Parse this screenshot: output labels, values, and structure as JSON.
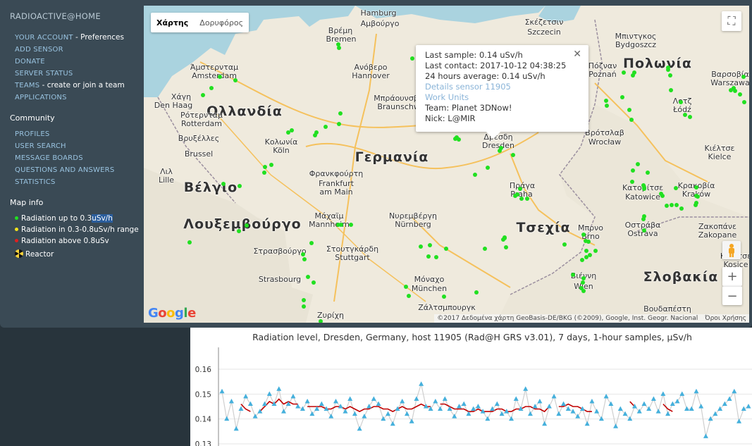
{
  "sidebar": {
    "site_title": "RADIOACTIVE@HOME",
    "nav": [
      {
        "label": "YOUR ACCOUNT",
        "suffix": " - Preferences"
      },
      {
        "label": "ADD SENSOR",
        "suffix": ""
      },
      {
        "label": "DONATE",
        "suffix": ""
      },
      {
        "label": "SERVER STATUS",
        "suffix": ""
      },
      {
        "label": "TEAMS",
        "suffix": " - create or join a team"
      },
      {
        "label": "APPLICATIONS",
        "suffix": ""
      }
    ],
    "community_heading": "Community",
    "community": [
      "PROFILES",
      "USER SEARCH",
      "MESSAGE BOARDS",
      "QUESTIONS AND ANSWERS",
      "STATISTICS"
    ],
    "mapinfo_heading": "Map info",
    "legend": {
      "green_prefix": "Radiation up to 0.3",
      "green_highlight": "uSv/h",
      "yellow": "Radiation in 0.3-0.8uSv/h range",
      "red": "Radiation above 0.8uSv",
      "reactor": "Reactor"
    },
    "colors": {
      "green": "#21e021",
      "yellow": "#f2e21c",
      "red": "#e02020"
    }
  },
  "map": {
    "map_type": {
      "map": "Χάρτης",
      "satellite": "Δορυφόρος"
    },
    "zoom_in": "+",
    "zoom_out": "−",
    "google": "Google",
    "attribution": "©2017 Δεδομένα χάρτη GeoBasis-DE/BKG (©2009), Google, Inst. Geogr. Nacional",
    "terms": "Όροι Χρήσης",
    "countries": [
      "Ολλανδία",
      "Γερμανία",
      "Βέλγιο",
      "Λουξεμβούργο",
      "Πολωνία",
      "Τσεχία",
      "Σλοβακία"
    ],
    "cities": [
      "Hamburg",
      "Βρέμη",
      "Bremen",
      "Αμβούργο",
      "Ανόβερο",
      "Hannover",
      "Μπράουνσβαϊγκ",
      "Braunschweig",
      "Άμστερνταμ",
      "Amsterdam",
      "Χάγη",
      "Den Haag",
      "Ρότερνταμ",
      "Rotterdam",
      "Βρυξέλλες",
      "Brussel",
      "Κολωνία",
      "Köln",
      "Λιλ",
      "Lille",
      "Φρανκφούρτη",
      "Frankfurt",
      "am Main",
      "Μάχαϊμ",
      "Mannheim",
      "Νυρεμβέργη",
      "Nürnberg",
      "Στουτγκάρδη",
      "Stuttgart",
      "Στρασβούργο",
      "Strasbourg",
      "Μόναχο",
      "München",
      "Ζάλτσμπουργκ",
      "Ζυρίχη",
      "Πράγα",
      "Praha",
      "Δρέσδη",
      "Dresden",
      "Μπρνο",
      "Brno",
      "Βιέννη",
      "Wien",
      "Σκέζετσιν",
      "Szczecin",
      "Μπιντγκος",
      "Bydgoszcz",
      "Πόζναν",
      "Poznań",
      "Βαρσοβία",
      "Warszawa",
      "Λοτζ",
      "Łódź",
      "Βρότσλαβ",
      "Wrocław",
      "Κιέλτσε",
      "Kielce",
      "Κατοβίτσε",
      "Katowice",
      "Κρακοβία",
      "Kraków",
      "Οστράβα",
      "Ostrava",
      "Ζακοπάνε",
      "Zakopane",
      "Κόσιτσε",
      "Kosice",
      "Βουδαπέστη"
    ]
  },
  "infowindow": {
    "last_sample": "Last sample: 0.14 uSv/h",
    "last_contact": "Last contact: 2017-10-12 04:38:25",
    "average": "24 hours average: 0.14 uSv/h",
    "details": "Details sensor 11905",
    "work_units": "Work Units",
    "team": "Team: Planet 3DNow!",
    "nick": "Nick: L@MIR",
    "close": "✕"
  },
  "chart_data": {
    "type": "line",
    "title": "Radiation level, Dresden, Germany,  host 11905 (Rad@H GRS v3.01), 7 days, 1-hour samples, µSv/h",
    "yticks": [
      "0.16",
      "0.15",
      "0.14",
      "0.13"
    ],
    "ylim": [
      0.13,
      0.165
    ],
    "grid": true,
    "series": [
      {
        "style": "markers",
        "color": "#45b0dc",
        "values": [
          0.151,
          0.14,
          0.147,
          0.136,
          0.144,
          0.149,
          0.146,
          0.141,
          0.143,
          0.146,
          0.15,
          0.146,
          0.152,
          0.143,
          0.146,
          0.149,
          0.145,
          0.144,
          0.147,
          0.142,
          0.144,
          0.146,
          0.144,
          0.141,
          0.147,
          0.145,
          0.143,
          0.148,
          0.142,
          0.136,
          0.141,
          0.145,
          0.148,
          0.146,
          0.14,
          0.142,
          0.138,
          0.144,
          0.147,
          0.142,
          0.139,
          0.148,
          0.154,
          0.145,
          0.144,
          0.147,
          0.144,
          0.148,
          0.144,
          0.141,
          0.145,
          0.146,
          0.142,
          0.144,
          0.145,
          0.143,
          0.14,
          0.144,
          0.146,
          0.142,
          0.143,
          0.14,
          0.148,
          0.144,
          0.152,
          0.142,
          0.145,
          0.147,
          0.138,
          0.145,
          0.149,
          0.142,
          0.146,
          0.144,
          0.143,
          0.141,
          0.144,
          0.138,
          0.147,
          0.143,
          0.14,
          0.149,
          0.146,
          0.137,
          0.144,
          0.142,
          0.14,
          0.145,
          0.143,
          0.146,
          0.144,
          0.148,
          0.143,
          0.15,
          0.142,
          0.146,
          0.147,
          0.15,
          0.144,
          0.144,
          0.151,
          0.145,
          0.133,
          0.14,
          0.142,
          0.144,
          0.146,
          0.148,
          0.151,
          0.139,
          0.144,
          0.145
        ]
      },
      {
        "style": "line",
        "color": "#c00000",
        "values": [
          null,
          null,
          null,
          null,
          0.146,
          0.144,
          0.143,
          null,
          0.143,
          0.145,
          0.147,
          0.146,
          0.148,
          0.146,
          0.147,
          0.146,
          0.146,
          null,
          0.145,
          0.145,
          0.145,
          0.145,
          0.144,
          0.144,
          0.145,
          0.145,
          0.144,
          0.145,
          0.144,
          0.143,
          0.144,
          0.144,
          0.145,
          0.145,
          0.144,
          0.144,
          0.143,
          0.144,
          0.145,
          0.144,
          0.144,
          0.145,
          0.146,
          0.145,
          0.145,
          null,
          0.146,
          0.146,
          0.145,
          0.144,
          0.144,
          0.144,
          0.143,
          0.143,
          0.144,
          0.143,
          0.143,
          0.143,
          0.144,
          0.144,
          0.143,
          0.143,
          0.144,
          0.144,
          0.145,
          0.145,
          0.144,
          0.144,
          0.143,
          0.145,
          null,
          0.145,
          0.145,
          0.146,
          0.145,
          0.145,
          0.144,
          0.143,
          0.143,
          null,
          null,
          null,
          null,
          null,
          null,
          null,
          0.147,
          0.145,
          null,
          null,
          null,
          null,
          null,
          0.146,
          0.144,
          0.143,
          null,
          null,
          null,
          null,
          null,
          null,
          null,
          null,
          null,
          null,
          null,
          null,
          null,
          null,
          null,
          null
        ]
      }
    ]
  }
}
